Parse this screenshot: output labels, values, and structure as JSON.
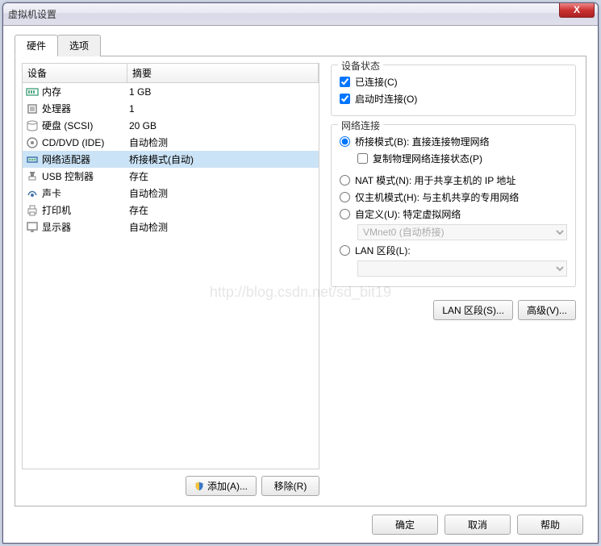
{
  "window": {
    "title": "虚拟机设置",
    "close": "X"
  },
  "tabs": {
    "hardware": "硬件",
    "options": "选项"
  },
  "table": {
    "col_device": "设备",
    "col_summary": "摘要",
    "rows": [
      {
        "name": "内存",
        "summary": "1 GB"
      },
      {
        "name": "处理器",
        "summary": "1"
      },
      {
        "name": "硬盘 (SCSI)",
        "summary": "20 GB"
      },
      {
        "name": "CD/DVD (IDE)",
        "summary": "自动检测"
      },
      {
        "name": "网络适配器",
        "summary": "桥接模式(自动)"
      },
      {
        "name": "USB 控制器",
        "summary": "存在"
      },
      {
        "name": "声卡",
        "summary": "自动检测"
      },
      {
        "name": "打印机",
        "summary": "存在"
      },
      {
        "name": "显示器",
        "summary": "自动检测"
      }
    ]
  },
  "leftbuttons": {
    "add": "添加(A)...",
    "remove": "移除(R)"
  },
  "status": {
    "title": "设备状态",
    "connected": "已连接(C)",
    "connect_on_power": "启动时连接(O)"
  },
  "net": {
    "title": "网络连接",
    "bridged": "桥接模式(B): 直接连接物理网络",
    "replicate": "复制物理网络连接状态(P)",
    "nat": "NAT 模式(N): 用于共享主机的 IP 地址",
    "hostonly": "仅主机模式(H): 与主机共享的专用网络",
    "custom": "自定义(U): 特定虚拟网络",
    "custom_value": "VMnet0 (自动桥接)",
    "lan": "LAN 区段(L):",
    "lan_value": ""
  },
  "rightbuttons": {
    "lanseg": "LAN 区段(S)...",
    "advanced": "高级(V)..."
  },
  "footer": {
    "ok": "确定",
    "cancel": "取消",
    "help": "帮助"
  },
  "watermark": "http://blog.csdn.net/sd_bit19"
}
